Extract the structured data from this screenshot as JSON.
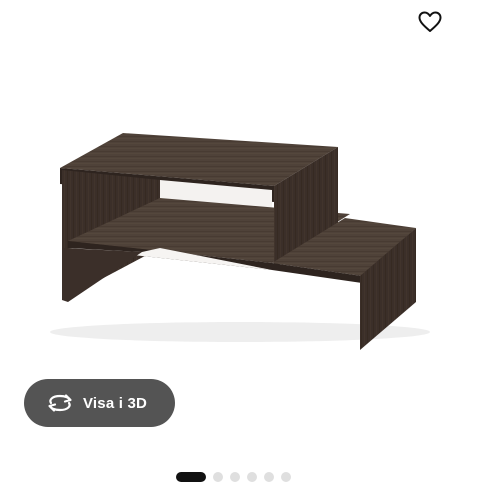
{
  "product_gallery": {
    "favorite_icon": "heart-outline-icon",
    "product_image": "dark-brown-coffee-table-photo",
    "view3d": {
      "icon": "rotate-3d-icon",
      "label": "Visa i 3D"
    },
    "pagination": {
      "total": 6,
      "active_index": 0
    }
  },
  "colors": {
    "button_bg": "#545454",
    "button_text": "#ffffff",
    "dot_active": "#111111",
    "dot_inactive": "#dfdfdf",
    "wood_top": "#4f4239",
    "wood_front": "#3b2f29",
    "wood_dark": "#2e241f"
  }
}
